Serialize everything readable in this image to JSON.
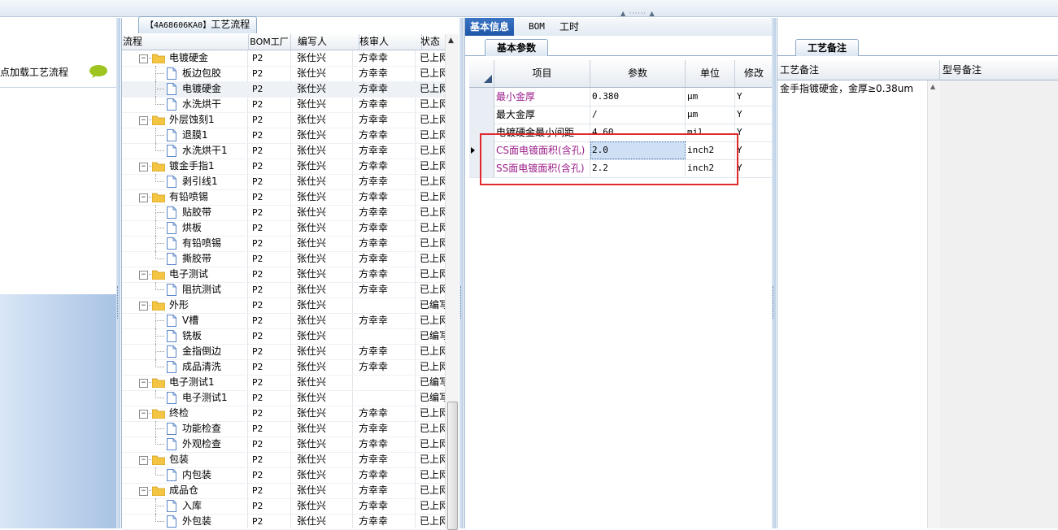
{
  "left": {
    "load_text": "节点加载工艺流程"
  },
  "tree": {
    "tab_code": "【4A68606KA0】",
    "tab_label": "工艺流程",
    "headers": [
      "流程",
      "BOM工厂",
      "编写人",
      "核审人",
      "状态"
    ],
    "rows": [
      {
        "name": "电镀硬金",
        "group": true,
        "bom": "P2",
        "writer": "张仕兴",
        "reviewer": "方幸幸",
        "status": "已上网"
      },
      {
        "name": "板边包胶",
        "group": false,
        "bom": "P2",
        "writer": "张仕兴",
        "reviewer": "方幸幸",
        "status": "已上网"
      },
      {
        "name": "电镀硬金",
        "group": false,
        "bom": "P2",
        "writer": "张仕兴",
        "reviewer": "方幸幸",
        "status": "已上网",
        "selected": true
      },
      {
        "name": "水洗烘干",
        "group": false,
        "bom": "P2",
        "writer": "张仕兴",
        "reviewer": "方幸幸",
        "status": "已上网"
      },
      {
        "name": "外层蚀刻1",
        "group": true,
        "bom": "P2",
        "writer": "张仕兴",
        "reviewer": "方幸幸",
        "status": "已上网"
      },
      {
        "name": "退膜1",
        "group": false,
        "bom": "P2",
        "writer": "张仕兴",
        "reviewer": "方幸幸",
        "status": "已上网"
      },
      {
        "name": "水洗烘干1",
        "group": false,
        "bom": "P2",
        "writer": "张仕兴",
        "reviewer": "方幸幸",
        "status": "已上网"
      },
      {
        "name": "镀金手指1",
        "group": true,
        "bom": "P2",
        "writer": "张仕兴",
        "reviewer": "方幸幸",
        "status": "已上网"
      },
      {
        "name": "剥引线1",
        "group": false,
        "bom": "P2",
        "writer": "张仕兴",
        "reviewer": "方幸幸",
        "status": "已上网"
      },
      {
        "name": "有铅喷锡",
        "group": true,
        "bom": "P2",
        "writer": "张仕兴",
        "reviewer": "方幸幸",
        "status": "已上网"
      },
      {
        "name": "贴胶带",
        "group": false,
        "bom": "P2",
        "writer": "张仕兴",
        "reviewer": "方幸幸",
        "status": "已上网"
      },
      {
        "name": "烘板",
        "group": false,
        "bom": "P2",
        "writer": "张仕兴",
        "reviewer": "方幸幸",
        "status": "已上网"
      },
      {
        "name": "有铅喷锡",
        "group": false,
        "bom": "P2",
        "writer": "张仕兴",
        "reviewer": "方幸幸",
        "status": "已上网"
      },
      {
        "name": "撕胶带",
        "group": false,
        "bom": "P2",
        "writer": "张仕兴",
        "reviewer": "方幸幸",
        "status": "已上网"
      },
      {
        "name": "电子测试",
        "group": true,
        "bom": "P2",
        "writer": "张仕兴",
        "reviewer": "方幸幸",
        "status": "已上网"
      },
      {
        "name": "阻抗测试",
        "group": false,
        "bom": "P2",
        "writer": "张仕兴",
        "reviewer": "方幸幸",
        "status": "已上网"
      },
      {
        "name": "外形",
        "group": true,
        "bom": "P2",
        "writer": "张仕兴",
        "reviewer": "",
        "status": "已编写"
      },
      {
        "name": "V槽",
        "group": false,
        "bom": "P2",
        "writer": "张仕兴",
        "reviewer": "方幸幸",
        "status": "已上网"
      },
      {
        "name": "铣板",
        "group": false,
        "bom": "P2",
        "writer": "张仕兴",
        "reviewer": "",
        "status": "已编写"
      },
      {
        "name": "金指倒边",
        "group": false,
        "bom": "P2",
        "writer": "张仕兴",
        "reviewer": "方幸幸",
        "status": "已上网"
      },
      {
        "name": "成品清洗",
        "group": false,
        "bom": "P2",
        "writer": "张仕兴",
        "reviewer": "方幸幸",
        "status": "已上网"
      },
      {
        "name": "电子测试1",
        "group": true,
        "bom": "P2",
        "writer": "张仕兴",
        "reviewer": "",
        "status": "已编写"
      },
      {
        "name": "电子测试1",
        "group": false,
        "bom": "P2",
        "writer": "张仕兴",
        "reviewer": "",
        "status": "已编写"
      },
      {
        "name": "终检",
        "group": true,
        "bom": "P2",
        "writer": "张仕兴",
        "reviewer": "方幸幸",
        "status": "已上网"
      },
      {
        "name": "功能检查",
        "group": false,
        "bom": "P2",
        "writer": "张仕兴",
        "reviewer": "方幸幸",
        "status": "已上网"
      },
      {
        "name": "外观检查",
        "group": false,
        "bom": "P2",
        "writer": "张仕兴",
        "reviewer": "方幸幸",
        "status": "已上网"
      },
      {
        "name": "包装",
        "group": true,
        "bom": "P2",
        "writer": "张仕兴",
        "reviewer": "方幸幸",
        "status": "已上网"
      },
      {
        "name": "内包装",
        "group": false,
        "bom": "P2",
        "writer": "张仕兴",
        "reviewer": "方幸幸",
        "status": "已上网"
      },
      {
        "name": "成品仓",
        "group": true,
        "bom": "P2",
        "writer": "张仕兴",
        "reviewer": "方幸幸",
        "status": "已上网"
      },
      {
        "name": "入库",
        "group": false,
        "bom": "P2",
        "writer": "张仕兴",
        "reviewer": "方幸幸",
        "status": "已上网"
      },
      {
        "name": "外包装",
        "group": false,
        "bom": "P2",
        "writer": "张仕兴",
        "reviewer": "方幸幸",
        "status": "已上网"
      }
    ]
  },
  "main": {
    "tabs": [
      "基本信息",
      "BOM",
      "工时"
    ],
    "subtab": "基本参数",
    "grid_headers": [
      "项目",
      "参数",
      "单位",
      "修改"
    ],
    "params": [
      {
        "item": "最小金厚",
        "value": "0.380",
        "unit": "μm",
        "mod": "Y",
        "purple": true
      },
      {
        "item": "最大金厚",
        "value": "/",
        "unit": "μm",
        "mod": "Y",
        "purple": false
      },
      {
        "item": "电镀硬金最小间距",
        "value": "4.60",
        "unit": "mil",
        "mod": "Y",
        "purple": false
      },
      {
        "item": "CS面电镀面积(含孔)",
        "value": "2.0",
        "unit": "inch2",
        "mod": "Y",
        "purple": true,
        "current": true
      },
      {
        "item": "SS面电镀面积(含孔)",
        "value": "2.2",
        "unit": "inch2",
        "mod": "Y",
        "purple": true
      }
    ]
  },
  "remarks": {
    "tab": "工艺备注",
    "headers": [
      "工艺备注",
      "型号备注"
    ],
    "text": "金手指镀硬金，金厚≥0.38um"
  },
  "colors": {
    "accent": "#1f56a8",
    "highlight_box": "#e1282d",
    "purple_text": "#9b1c8a"
  }
}
